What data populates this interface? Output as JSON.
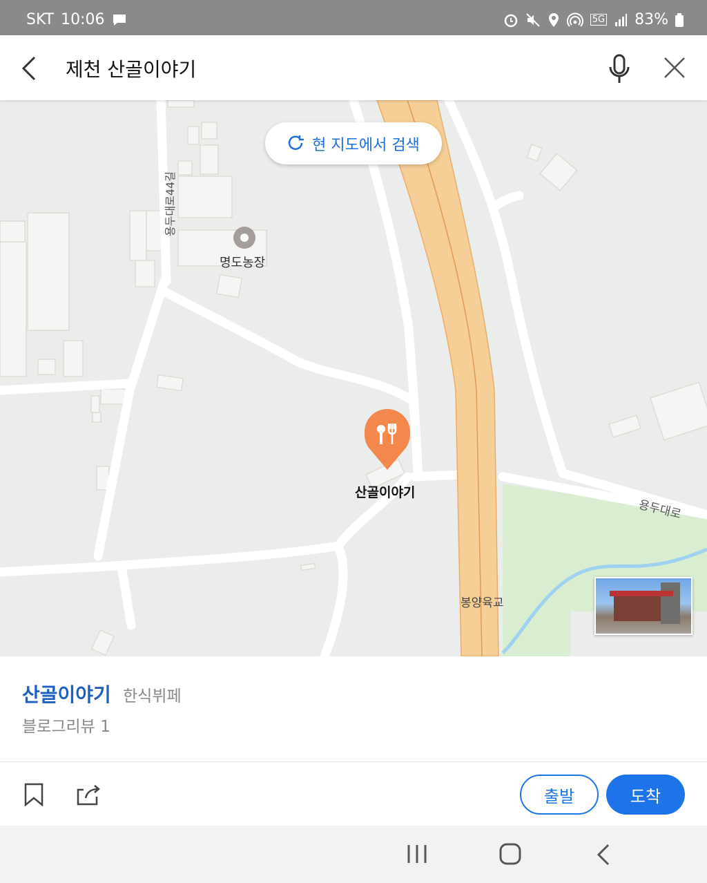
{
  "status": {
    "carrier": "SKT",
    "time": "10:06",
    "network": "5G",
    "battery": "83%",
    "icons": [
      "message-icon",
      "alarm-icon",
      "mute-icon",
      "location-icon",
      "hotspot-icon",
      "signal-icon",
      "battery-icon"
    ]
  },
  "search": {
    "query": "제천 산골이야기"
  },
  "map": {
    "search_here_label": "현 지도에서 검색",
    "labels": {
      "farm": "명도농장",
      "road_vertical": "용두대로44길",
      "road_main": "용두대로",
      "bridge": "봉양육교",
      "marker": "산골이야기"
    }
  },
  "place": {
    "name": "산골이야기",
    "category": "한식뷔페",
    "review": "블로그리뷰 1"
  },
  "actions": {
    "depart": "출발",
    "arrive": "도착"
  },
  "colors": {
    "accent": "#1d73e8",
    "marker": "#f4874b",
    "highway": "#f6cf96",
    "park": "#d9eed0",
    "water": "#9fd2f0"
  }
}
